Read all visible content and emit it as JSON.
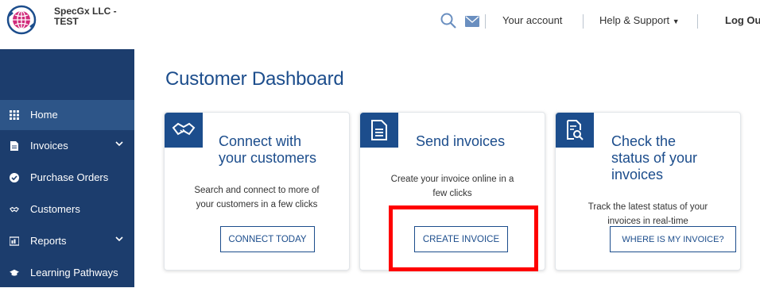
{
  "header": {
    "company_line1": "SpecGx LLC -",
    "company_line2": "TEST",
    "links": {
      "account": "Your account",
      "help": "Help & Support",
      "logout": "Log Out"
    },
    "icons": {
      "search": "search-icon",
      "mail": "mail-icon",
      "help_dropdown": "caret-down-icon"
    }
  },
  "sidebar": {
    "items": [
      {
        "label": "Home",
        "icon": "grid-icon",
        "active": true
      },
      {
        "label": "Invoices",
        "icon": "document-icon",
        "chevron": "chevron-down-icon"
      },
      {
        "label": "Purchase Orders",
        "icon": "check-circle-icon"
      },
      {
        "label": "Customers",
        "icon": "handshake-icon"
      },
      {
        "label": "Reports",
        "icon": "report-icon",
        "chevron": "chevron-down-icon"
      },
      {
        "label": "Learning Pathways",
        "icon": "graduation-cap-icon"
      }
    ]
  },
  "main": {
    "title": "Customer Dashboard",
    "cards": [
      {
        "title_line1": "Connect with",
        "title_line2": "your customers",
        "title_line3": "",
        "desc_line1": "Search and connect to more of",
        "desc_line2": "your customers in a few clicks",
        "button": "CONNECT TODAY",
        "icon": "handshake-icon"
      },
      {
        "title_line1": "Send invoices",
        "title_line2": "",
        "title_line3": "",
        "desc_line1": "Create your invoice online in a",
        "desc_line2": "few clicks",
        "button": "CREATE INVOICE",
        "icon": "document-icon"
      },
      {
        "title_line1": "Check the",
        "title_line2": "status of your",
        "title_line3": "invoices",
        "desc_line1": "Track the latest status of your",
        "desc_line2": "invoices in real-time",
        "button": "WHERE IS MY INVOICE?",
        "icon": "search-document-icon"
      }
    ]
  },
  "colors": {
    "sidebar_bg": "#1c3d6d",
    "sidebar_active": "#2d5588",
    "brand_blue": "#1c4d8c",
    "highlight": "#ff0000"
  }
}
